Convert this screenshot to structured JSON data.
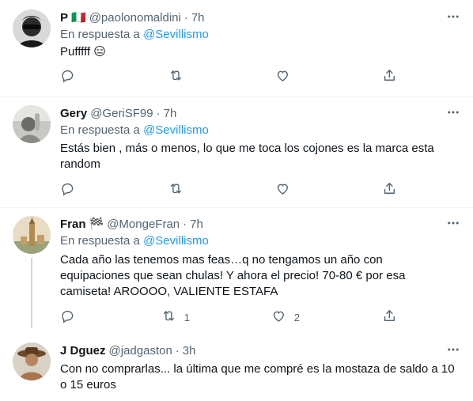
{
  "colors": {
    "accent": "#1d9bf0",
    "secondary_text": "#536471",
    "primary_text": "#0f1419",
    "divider": "#eff3f4"
  },
  "tweets": [
    {
      "name": "P",
      "flag": "🇮🇹",
      "handle": "@paolonomaldini",
      "dot": "·",
      "time": "7h",
      "reply_prefix": "En respuesta a ",
      "reply_mention": "@Sevillismo",
      "text": "Pufffff 😑",
      "counts": {
        "reply": "",
        "retweet": "",
        "like": ""
      },
      "icons": [
        "reply-icon",
        "retweet-icon",
        "like-icon",
        "share-icon",
        "more-icon"
      ]
    },
    {
      "name": "Gery",
      "handle": "@GeriSF99",
      "dot": "·",
      "time": "7h",
      "reply_prefix": "En respuesta a ",
      "reply_mention": "@Sevillismo",
      "text": "Estás bien , más o menos, lo que me toca los cojones es la marca esta random",
      "counts": {
        "reply": "",
        "retweet": "",
        "like": ""
      },
      "icons": [
        "reply-icon",
        "retweet-icon",
        "like-icon",
        "share-icon",
        "more-icon"
      ]
    },
    {
      "name": "Fran",
      "flag": "🏁",
      "handle": "@MongeFran",
      "dot": "·",
      "time": "7h",
      "reply_prefix": "En respuesta a ",
      "reply_mention": "@Sevillismo",
      "text": "Cada año las tenemos mas feas…q no tengamos un año con equipaciones que sean chulas! Y ahora el precio! 70-80 € por esa camiseta! AROOOO, VALIENTE ESTAFA",
      "counts": {
        "reply": "",
        "retweet": "1",
        "like": "2"
      },
      "icons": [
        "reply-icon",
        "retweet-icon",
        "like-icon",
        "share-icon",
        "more-icon"
      ]
    },
    {
      "name": "J Dguez",
      "handle": "@jadgaston",
      "dot": "·",
      "time": "3h",
      "text": "Con no comprarlas... la última que me compré es la mostaza de saldo a 10 o 15 euros",
      "icons": [
        "more-icon"
      ]
    }
  ]
}
